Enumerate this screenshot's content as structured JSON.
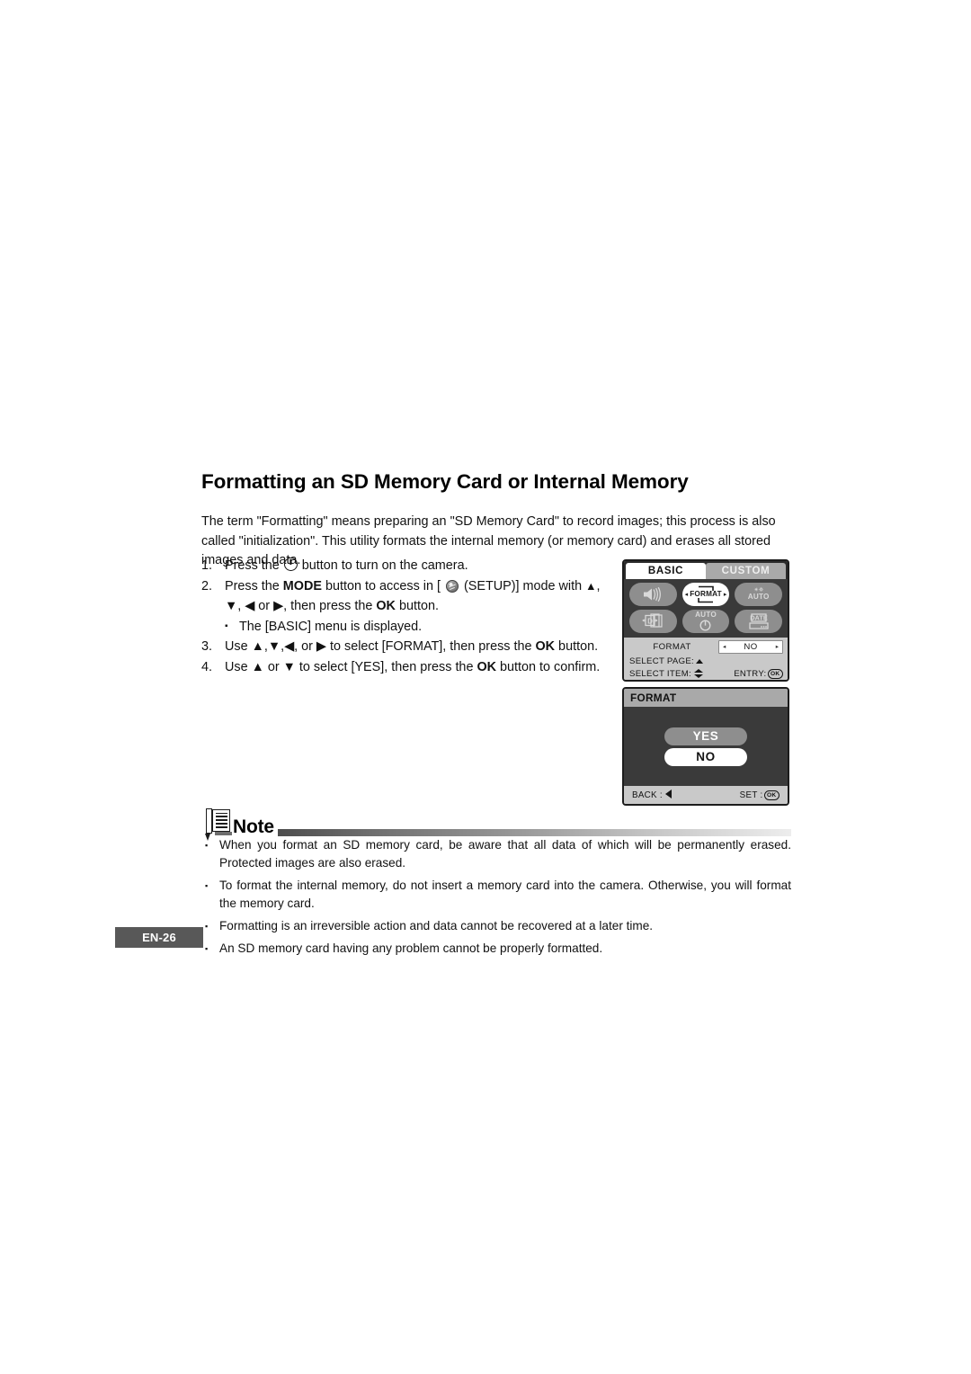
{
  "document": {
    "title": "Formatting an SD Memory Card or Internal Memory",
    "intro": "The term \"Formatting\" means preparing an \"SD Memory Card\" to record images; this process is also called \"initialization\". This utility formats the internal memory (or memory card) and erases all stored images and data.",
    "page_label": "EN-26"
  },
  "steps": [
    {
      "num": "1.",
      "pre": "Press the ",
      "post": " button to turn on the camera."
    },
    {
      "num": "2.",
      "p1": "Press the ",
      "bold1": "MODE",
      "p2": " button to access in [ ",
      "p3": " (SETUP)] mode with ",
      "arrow1": "▲",
      "p4": ",",
      "l2_a": "▼, ◀ or ▶, then press the ",
      "l2_bold": "OK",
      "l2_b": " button.",
      "sub_bullet": "▪",
      "sub_text": "The [BASIC] menu is displayed."
    },
    {
      "num": "3.",
      "a": "Use ▲,▼,◀, or ▶ to select [FORMAT], then press the ",
      "bold": "OK",
      "b": " button."
    },
    {
      "num": "4.",
      "a": "Use ▲ or ▼ to select [YES], then press the ",
      "bold": "OK",
      "b": " button to confirm."
    }
  ],
  "lcd_menu": {
    "tabs": [
      {
        "label": "BASIC",
        "active": true
      },
      {
        "label": "CUSTOM",
        "active": false
      }
    ],
    "tiles": [
      {
        "name": "volume-icon",
        "caption": "",
        "selected": false
      },
      {
        "name": "format-icon",
        "caption": "FORMAT",
        "selected": true
      },
      {
        "name": "flash-auto-icon",
        "caption": "AUTO",
        "selected": false
      },
      {
        "name": "digital-zoom-icon",
        "caption": "D",
        "selected": false
      },
      {
        "name": "auto-power-off-icon",
        "caption": "AUTO",
        "selected": false
      },
      {
        "name": "date-stamp-icon",
        "caption": "DATE",
        "selected": false
      }
    ],
    "info_label": "FORMAT",
    "info_value": "NO",
    "cursor_left": "◂",
    "cursor_right": "▸",
    "select_page_label": "SELECT PAGE:",
    "select_item_label": "SELECT ITEM:",
    "entry_label": "ENTRY:",
    "entry_badge": "OK"
  },
  "lcd_confirm": {
    "title": "FORMAT",
    "choices": [
      {
        "label": "YES",
        "selected": false
      },
      {
        "label": "NO",
        "selected": true
      }
    ],
    "back_label": "BACK :",
    "set_label": "SET :",
    "set_badge": "OK"
  },
  "note": {
    "heading": "Note",
    "bullet": "▪",
    "items": [
      "When you format an SD memory card, be aware that all data of which will be permanently erased. Protected images are also erased.",
      "To format the internal memory, do not insert a memory card into the camera. Otherwise, you will format the memory card.",
      "Formatting is an irreversible action and data cannot be recovered at a later time.",
      "An SD memory card having any problem cannot be properly formatted."
    ]
  },
  "colors": {
    "page_badge_bg": "#585858",
    "lcd_border": "#1c1c1c",
    "lcd_chrome": "#c9c9c9",
    "lcd_dark": "#3a3a3a",
    "tile_bg": "#8e8e8e",
    "tab_inactive": "#a9a9a9"
  }
}
